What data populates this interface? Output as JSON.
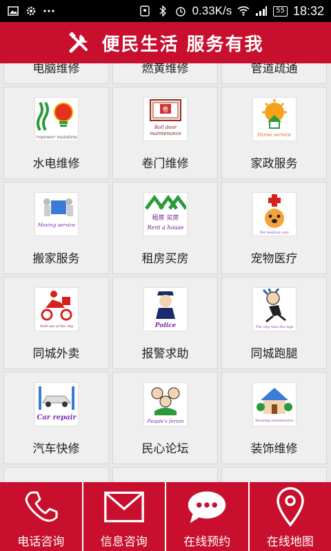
{
  "status_bar": {
    "speed": "0.33K/s",
    "battery": "55",
    "time": "18:32",
    "icons": [
      "image-icon",
      "settings-icon",
      "more-icon",
      "location-icon",
      "bluetooth-icon",
      "alarm-icon",
      "wifi-icon",
      "signal-icon",
      "battery-icon"
    ]
  },
  "header": {
    "title": "便民生活 服务有我",
    "icon": "tools-icon"
  },
  "partial_top_row": [
    {
      "label": "电脑维修"
    },
    {
      "label": "燃黄维修"
    },
    {
      "label": "管道疏通"
    }
  ],
  "services": [
    {
      "label": "水电维修",
      "icon_caption": "Hydropower maintenance",
      "icon": "lightbulb-icon"
    },
    {
      "label": "卷门维修",
      "icon_caption": "Roll door maintenance",
      "icon": "roll-door-icon"
    },
    {
      "label": "家政服务",
      "icon_caption": "Home service",
      "icon": "home-service-icon"
    },
    {
      "label": "搬家服务",
      "icon_caption": "Moving service",
      "icon": "moving-icon"
    },
    {
      "label": "租房买房",
      "icon_caption": "Rent a house",
      "icon": "rent-house-icon",
      "icon_text": "租房 买房"
    },
    {
      "label": "宠物医疗",
      "icon_caption": "Pet medical care",
      "icon": "pet-medical-icon"
    },
    {
      "label": "同城外卖",
      "icon_caption": "Sold out of the city",
      "icon": "delivery-icon"
    },
    {
      "label": "报警求助",
      "icon_caption": "Police",
      "icon": "police-icon"
    },
    {
      "label": "同城跑腿",
      "icon_caption": "The city runs the legs",
      "icon": "errand-runner-icon"
    },
    {
      "label": "汽车快修",
      "icon_caption": "Car repair",
      "icon": "car-repair-icon"
    },
    {
      "label": "民心论坛",
      "icon_caption": "People's forum",
      "icon": "forum-icon"
    },
    {
      "label": "装饰维修",
      "icon_caption": "Housing maintenance",
      "icon": "housing-maintenance-icon"
    }
  ],
  "bottom_nav": [
    {
      "label": "电话咨询",
      "icon": "phone-icon"
    },
    {
      "label": "信息咨询",
      "icon": "mail-icon"
    },
    {
      "label": "在线预约",
      "icon": "chat-icon"
    },
    {
      "label": "在线地图",
      "icon": "map-pin-icon"
    }
  ],
  "colors": {
    "brand_red": "#c8102e",
    "cell_bg": "#efefef",
    "status_bar": "#000000"
  }
}
